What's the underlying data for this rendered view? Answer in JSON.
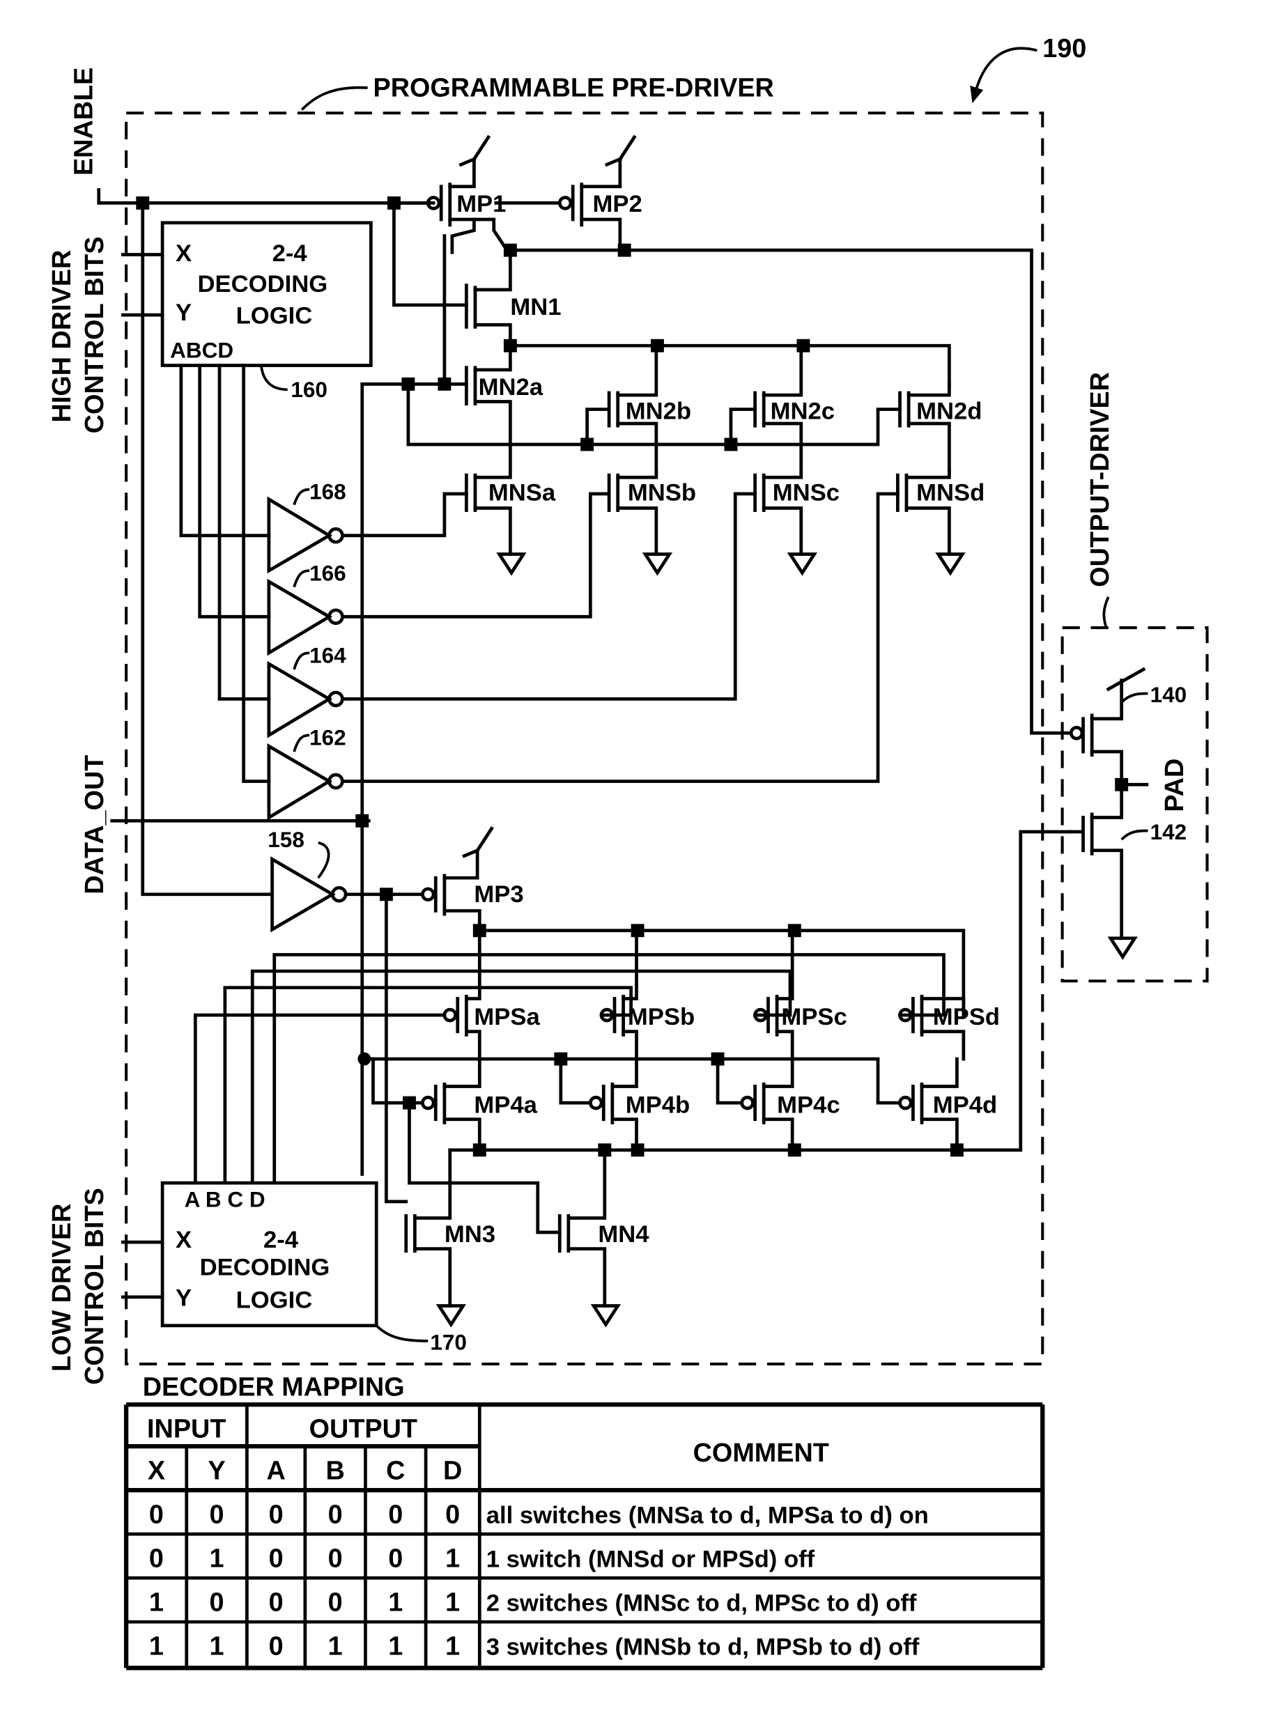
{
  "figure": {
    "reference": "190",
    "pre_driver_title": "PROGRAMMABLE PRE-DRIVER",
    "output_driver_title": "OUTPUT-DRIVER"
  },
  "signals": {
    "enable": "ENABLE",
    "high_driver_line1": "HIGH DRIVER",
    "high_driver_line2": "CONTROL BITS",
    "data_out": "DATA_OUT",
    "low_driver_line1": "LOW DRIVER",
    "low_driver_line2": "CONTROL BITS",
    "pad": "PAD"
  },
  "decoders": {
    "high": {
      "ref": "160",
      "in_x": "X",
      "in_y": "Y",
      "line1": "2-4",
      "line2": "DECODING",
      "line3": "LOGIC",
      "outputs": "ABCD"
    },
    "low": {
      "ref": "170",
      "in_x": "X",
      "in_y": "Y",
      "line1": "2-4",
      "line2": "DECODING",
      "line3": "LOGIC",
      "outputs": "A B C D"
    }
  },
  "inverters": {
    "i168": "168",
    "i166": "166",
    "i164": "164",
    "i162": "162",
    "i158": "158"
  },
  "transistors": {
    "mp1": "MP1",
    "mp2": "MP2",
    "mn1": "MN1",
    "mn2a": "MN2a",
    "mn2b": "MN2b",
    "mn2c": "MN2c",
    "mn2d": "MN2d",
    "mnsa": "MNSa",
    "mnsb": "MNSb",
    "mnsc": "MNSc",
    "mnsd": "MNSd",
    "mp3": "MP3",
    "mpsa": "MPSa",
    "mpsb": "MPSb",
    "mpsc": "MPSc",
    "mpsd": "MPSd",
    "mp4a": "MP4a",
    "mp4b": "MP4b",
    "mp4c": "MP4c",
    "mp4d": "MP4d",
    "mn3": "MN3",
    "mn4": "MN4",
    "out_p": "140",
    "out_n": "142"
  },
  "table": {
    "title": "DECODER MAPPING",
    "group_input": "INPUT",
    "group_output": "OUTPUT",
    "comment_header": "COMMENT",
    "columns": [
      "X",
      "Y",
      "A",
      "B",
      "C",
      "D"
    ],
    "rows": [
      {
        "cells": [
          "0",
          "0",
          "0",
          "0",
          "0",
          "0"
        ],
        "comment": "all switches (MNSa to d, MPSa to d) on"
      },
      {
        "cells": [
          "0",
          "1",
          "0",
          "0",
          "0",
          "1"
        ],
        "comment": "1 switch (MNSd or MPSd) off"
      },
      {
        "cells": [
          "1",
          "0",
          "0",
          "0",
          "1",
          "1"
        ],
        "comment": "2 switches (MNSc to d, MPSc to d) off"
      },
      {
        "cells": [
          "1",
          "1",
          "0",
          "1",
          "1",
          "1"
        ],
        "comment": "3 switches (MNSb to d, MPSb to d) off"
      }
    ]
  }
}
